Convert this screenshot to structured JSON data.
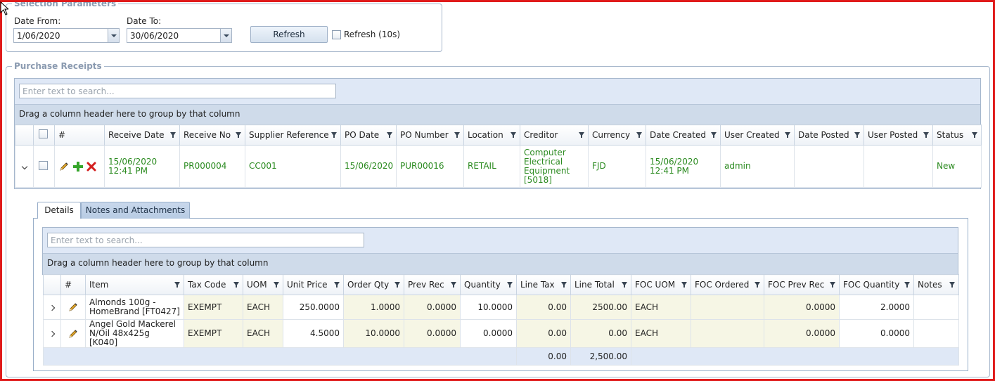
{
  "selection": {
    "legend": "Selection Parameters",
    "date_from_label": "Date From:",
    "date_from_value": "1/06/2020",
    "date_to_label": "Date To:",
    "date_to_value": "30/06/2020",
    "refresh_label": "Refresh",
    "auto_refresh_label": "Refresh (10s)"
  },
  "receipts": {
    "legend": "Purchase Receipts",
    "search_placeholder": "Enter text to search...",
    "group_hint": "Drag a column header here to group by that column",
    "columns": [
      "#",
      "Receive Date",
      "Receive No",
      "Supplier Reference",
      "PO Date",
      "PO Number",
      "Location",
      "Creditor",
      "Currency",
      "Date Created",
      "User Created",
      "Date Posted",
      "User Posted",
      "Status"
    ],
    "rows": [
      {
        "receive_date": "15/06/2020\n12:41 PM",
        "receive_no": "PR000004",
        "supplier_ref": "CC001",
        "po_date": "15/06/2020",
        "po_number": "PUR00016",
        "location": "RETAIL",
        "creditor": "Computer\nElectrical\nEquipment\n[5018]",
        "currency": "FJD",
        "date_created": "15/06/2020\n12:41 PM",
        "user_created": "admin",
        "date_posted": "",
        "user_posted": "",
        "status": "New"
      }
    ]
  },
  "detail": {
    "tabs": [
      "Details",
      "Notes and Attachments"
    ],
    "search_placeholder": "Enter text to search...",
    "group_hint": "Drag a column header here to group by that column",
    "columns": [
      "#",
      "Item",
      "Tax Code",
      "UOM",
      "Unit Price",
      "Order Qty",
      "Prev Rec",
      "Quantity",
      "Line Tax",
      "Line Total",
      "FOC UOM",
      "FOC Ordered",
      "FOC Prev Rec",
      "FOC Quantity",
      "Notes"
    ],
    "rows": [
      {
        "item": "Almonds 100g -\nHomeBrand [FT0427]",
        "tax_code": "EXEMPT",
        "uom": "EACH",
        "unit_price": "250.0000",
        "order_qty": "1.0000",
        "prev_rec": "0.0000",
        "quantity": "10.0000",
        "line_tax": "0.00",
        "line_total": "2500.00",
        "foc_uom": "EACH",
        "foc_ordered": "",
        "foc_prev_rec": "0.0000",
        "foc_quantity": "2.0000",
        "notes": ""
      },
      {
        "item": "Angel Gold Mackerel\nN/Oil 48x425g [K040]",
        "tax_code": "EXEMPT",
        "uom": "EACH",
        "unit_price": "4.5000",
        "order_qty": "10.0000",
        "prev_rec": "0.0000",
        "quantity": "0.0000",
        "line_tax": "0.00",
        "line_total": "0.00",
        "foc_uom": "EACH",
        "foc_ordered": "",
        "foc_prev_rec": "0.0000",
        "foc_quantity": "0.0000",
        "notes": ""
      }
    ],
    "summary": {
      "line_tax": "0.00",
      "line_total": "2,500.00"
    }
  },
  "colors": {
    "frame": "#e01b1b",
    "link_green": "#2a8a1f",
    "panel_blue": "#dfe8f6"
  }
}
